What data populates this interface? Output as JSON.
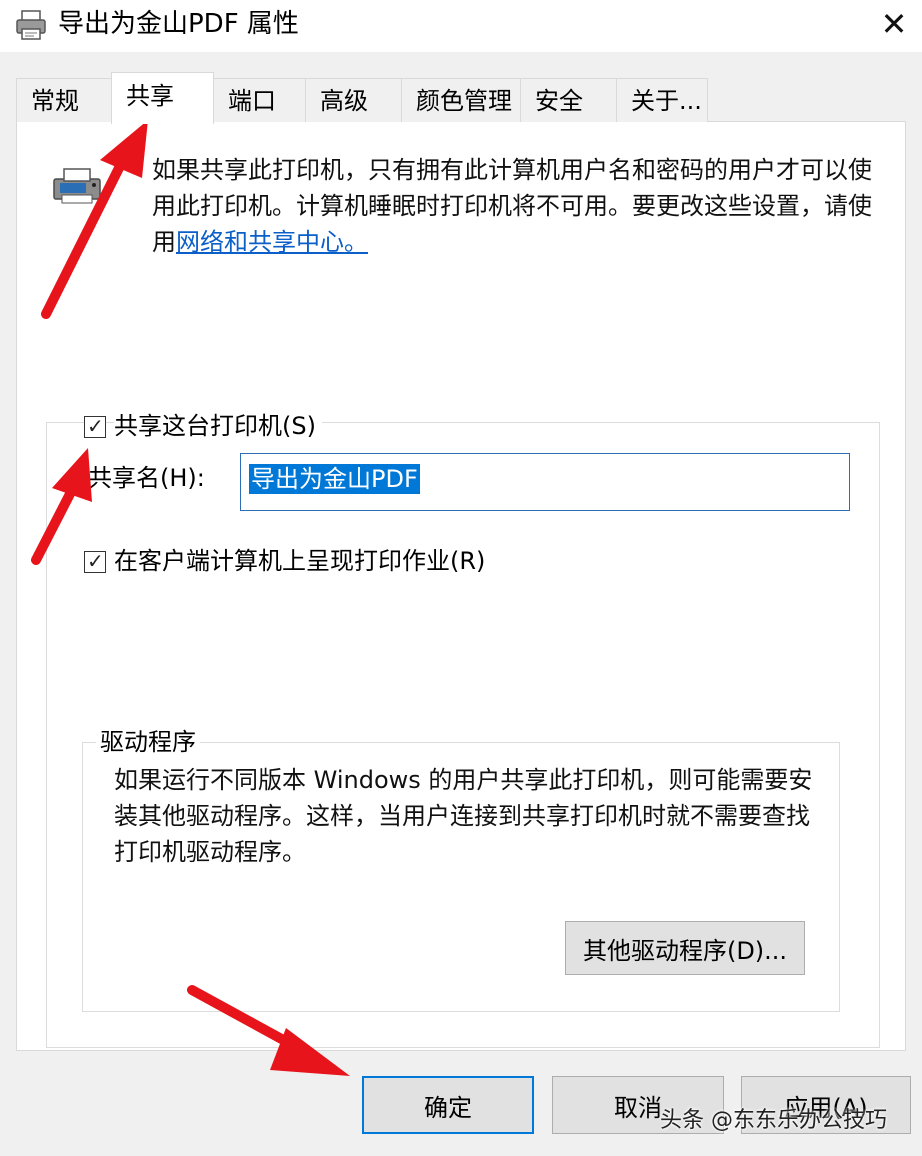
{
  "window": {
    "title": "导出为金山PDF 属性",
    "close_glyph": "✕"
  },
  "tabs": [
    {
      "label": "常规",
      "active": false
    },
    {
      "label": "共享",
      "active": true
    },
    {
      "label": "端口",
      "active": false
    },
    {
      "label": "高级",
      "active": false
    },
    {
      "label": "颜色管理",
      "active": false
    },
    {
      "label": "安全",
      "active": false
    },
    {
      "label": "关于...",
      "active": false
    }
  ],
  "sharing": {
    "info_text": "如果共享此打印机，只有拥有此计算机用户名和密码的用户才可以使用此打印机。计算机睡眠时打印机将不可用。要更改这些设置，请使用",
    "info_link": "网络和共享中心。",
    "share_checkbox_label": "共享这台打印机(S)",
    "share_checked": true,
    "share_name_label": "共享名(H):",
    "share_name_value": "导出为金山PDF",
    "render_checkbox_label": "在客户端计算机上呈现打印作业(R)",
    "render_checked": true
  },
  "drivers": {
    "group_title": "驱动程序",
    "description": "如果运行不同版本 Windows 的用户共享此打印机，则可能需要安装其他驱动程序。这样，当用户连接到共享打印机时就不需要查找打印机驱动程序。",
    "additional_drivers_button": "其他驱动程序(D)..."
  },
  "buttons": {
    "ok": "确定",
    "cancel": "取消",
    "apply": "应用(A)"
  },
  "watermark": "头条 @东东乐办公技巧",
  "colors": {
    "accent": "#0078d7",
    "link": "#0a5fc8",
    "annotation_arrow": "#e8141b"
  },
  "icons": {
    "title": "printer-icon",
    "info": "printer-icon",
    "close": "close-icon",
    "check": "checkmark-icon"
  }
}
